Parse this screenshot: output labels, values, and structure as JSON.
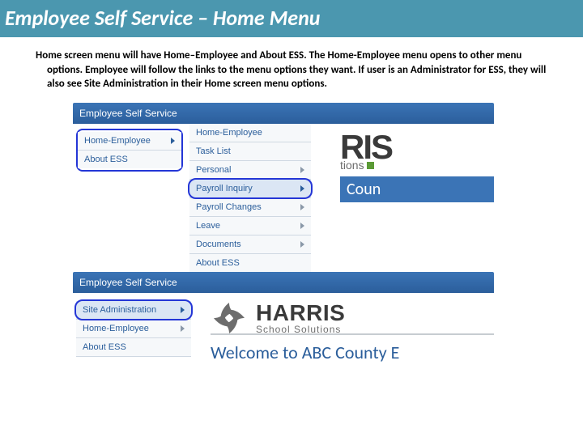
{
  "title": "Employee Self Service – Home Menu",
  "description": "Home screen menu will have Home–Employee and About ESS.  The Home-Employee menu opens to other menu options.  Employee will follow the links to the menu options they want.  If user is an Administrator for ESS, they will also see Site Administration in their Home screen menu options.",
  "shot1": {
    "banner": "Employee Self Service",
    "left_menu": [
      "Home-Employee",
      "About ESS"
    ],
    "right_menu": [
      "Home-Employee",
      "Task List",
      "Personal",
      "Payroll Inquiry",
      "Payroll Changes",
      "Leave",
      "Documents",
      "About ESS"
    ],
    "selected_right": "Payroll Inquiry",
    "brand_fragment_top": "RIS",
    "brand_fragment_mid": "tions",
    "brand_fragment_bottom": "Coun"
  },
  "shot2": {
    "banner": "Employee Self Service",
    "left_menu": [
      "Site Administration",
      "Home-Employee",
      "About ESS"
    ],
    "selected_left": "Site Administration",
    "brand_name": "HARRIS",
    "brand_sub": "School Solutions",
    "welcome": "Welcome to ABC County E"
  }
}
